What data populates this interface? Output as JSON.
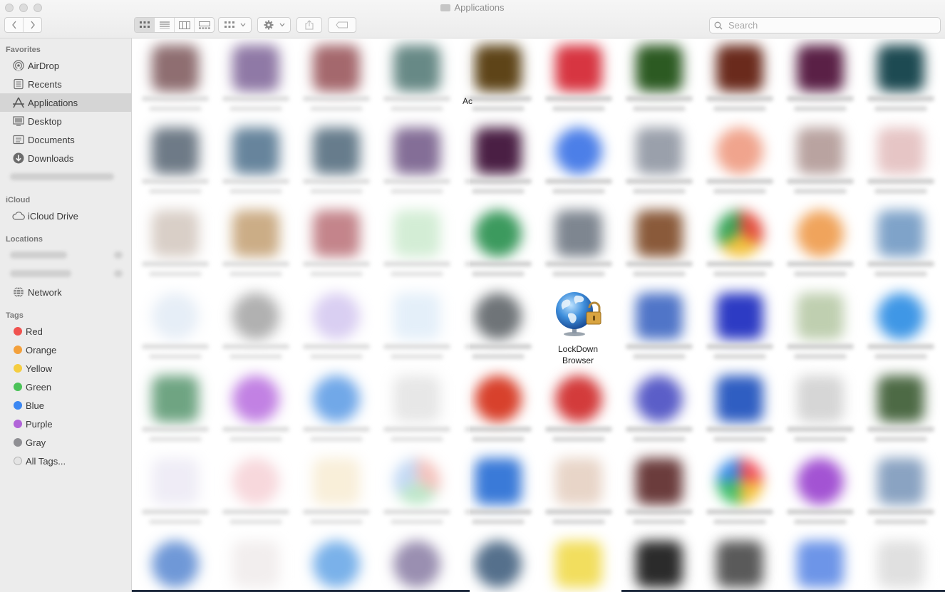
{
  "window": {
    "title": "Applications"
  },
  "toolbar": {
    "back_icon": "chevron-left-icon",
    "forward_icon": "chevron-right-icon",
    "view_modes": [
      "icon-view",
      "list-view",
      "column-view",
      "gallery-view"
    ],
    "active_view": "icon-view",
    "group_icon": "group-by-icon",
    "action_icon": "gear-icon",
    "share_icon": "share-icon",
    "tag_icon": "tag-icon",
    "search": {
      "placeholder": "Search",
      "value": ""
    }
  },
  "sidebar": {
    "favorites_header": "Favorites",
    "favorites": [
      {
        "label": "AirDrop",
        "icon": "airdrop-icon"
      },
      {
        "label": "Recents",
        "icon": "recents-icon"
      },
      {
        "label": "Applications",
        "icon": "applications-icon",
        "selected": true
      },
      {
        "label": "Desktop",
        "icon": "desktop-icon"
      },
      {
        "label": "Documents",
        "icon": "documents-icon"
      },
      {
        "label": "Downloads",
        "icon": "downloads-icon"
      }
    ],
    "icloud_header": "iCloud",
    "icloud": [
      {
        "label": "iCloud Drive",
        "icon": "cloud-icon"
      }
    ],
    "locations_header": "Locations",
    "locations": [
      {
        "label": "Network",
        "icon": "network-icon"
      }
    ],
    "tags_header": "Tags",
    "tags": [
      {
        "label": "Red",
        "color": "#f0524f"
      },
      {
        "label": "Orange",
        "color": "#f3a03b"
      },
      {
        "label": "Yellow",
        "color": "#f5cd40"
      },
      {
        "label": "Green",
        "color": "#4bc258"
      },
      {
        "label": "Blue",
        "color": "#3b87f2"
      },
      {
        "label": "Purple",
        "color": "#b164d8"
      },
      {
        "label": "Gray",
        "color": "#8f8f93"
      },
      {
        "label": "All Tags...",
        "color": "#e4e4e4"
      }
    ]
  },
  "content": {
    "partial_clipped_text": "Ac",
    "focused_app": {
      "name_line1": "LockDown",
      "name_line2": "Browser",
      "icon": "globe-lock-icon"
    }
  }
}
